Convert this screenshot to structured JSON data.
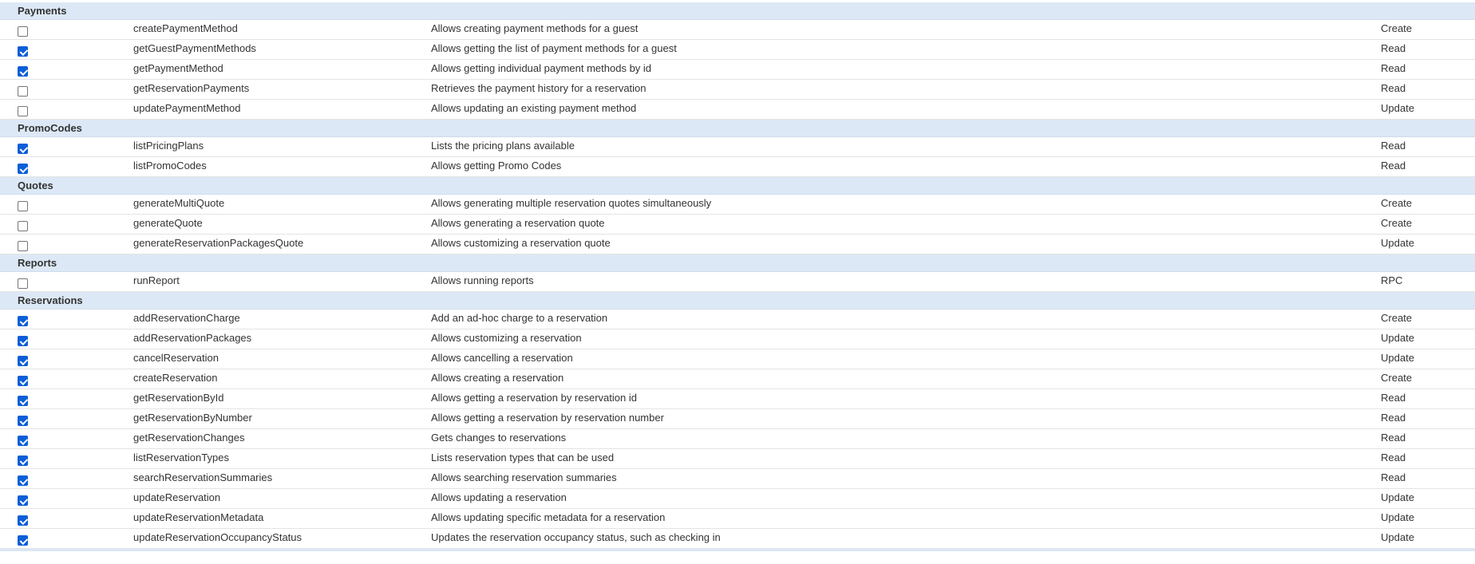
{
  "groups": [
    {
      "name": "Payments",
      "rows": [
        {
          "checked": false,
          "name": "createPaymentMethod",
          "description": "Allows creating payment methods for a guest",
          "type": "Create"
        },
        {
          "checked": true,
          "name": "getGuestPaymentMethods",
          "description": "Allows getting the list of payment methods for a guest",
          "type": "Read"
        },
        {
          "checked": true,
          "name": "getPaymentMethod",
          "description": "Allows getting individual payment methods by id",
          "type": "Read"
        },
        {
          "checked": false,
          "name": "getReservationPayments",
          "description": "Retrieves the payment history for a reservation",
          "type": "Read"
        },
        {
          "checked": false,
          "name": "updatePaymentMethod",
          "description": "Allows updating an existing payment method",
          "type": "Update"
        }
      ]
    },
    {
      "name": "PromoCodes",
      "rows": [
        {
          "checked": true,
          "name": "listPricingPlans",
          "description": "Lists the pricing plans available",
          "type": "Read"
        },
        {
          "checked": true,
          "name": "listPromoCodes",
          "description": "Allows getting Promo Codes",
          "type": "Read"
        }
      ]
    },
    {
      "name": "Quotes",
      "rows": [
        {
          "checked": false,
          "name": "generateMultiQuote",
          "description": "Allows generating multiple reservation quotes simultaneously",
          "type": "Create"
        },
        {
          "checked": false,
          "name": "generateQuote",
          "description": "Allows generating a reservation quote",
          "type": "Create"
        },
        {
          "checked": false,
          "name": "generateReservationPackagesQuote",
          "description": "Allows customizing a reservation quote",
          "type": "Update"
        }
      ]
    },
    {
      "name": "Reports",
      "rows": [
        {
          "checked": false,
          "name": "runReport",
          "description": "Allows running reports",
          "type": "RPC"
        }
      ]
    },
    {
      "name": "Reservations",
      "rows": [
        {
          "checked": true,
          "name": "addReservationCharge",
          "description": "Add an ad-hoc charge to a reservation",
          "type": "Create"
        },
        {
          "checked": true,
          "name": "addReservationPackages",
          "description": "Allows customizing a reservation",
          "type": "Update"
        },
        {
          "checked": true,
          "name": "cancelReservation",
          "description": "Allows cancelling a reservation",
          "type": "Update"
        },
        {
          "checked": true,
          "name": "createReservation",
          "description": "Allows creating a reservation",
          "type": "Create"
        },
        {
          "checked": true,
          "name": "getReservationById",
          "description": "Allows getting a reservation by reservation id",
          "type": "Read"
        },
        {
          "checked": true,
          "name": "getReservationByNumber",
          "description": "Allows getting a reservation by reservation number",
          "type": "Read"
        },
        {
          "checked": true,
          "name": "getReservationChanges",
          "description": "Gets changes to reservations",
          "type": "Read"
        },
        {
          "checked": true,
          "name": "listReservationTypes",
          "description": "Lists reservation types that can be used",
          "type": "Read"
        },
        {
          "checked": true,
          "name": "searchReservationSummaries",
          "description": "Allows searching reservation summaries",
          "type": "Read"
        },
        {
          "checked": true,
          "name": "updateReservation",
          "description": "Allows updating a reservation",
          "type": "Update"
        },
        {
          "checked": true,
          "name": "updateReservationMetadata",
          "description": "Allows updating specific metadata for a reservation",
          "type": "Update"
        },
        {
          "checked": true,
          "name": "updateReservationOccupancyStatus",
          "description": "Updates the reservation occupancy status, such as checking in",
          "type": "Update"
        }
      ]
    }
  ],
  "colors": {
    "group_header_bg": "#dce8f6",
    "checkbox_checked": "#0b5ed7",
    "row_divider": "#e4e4e4"
  }
}
